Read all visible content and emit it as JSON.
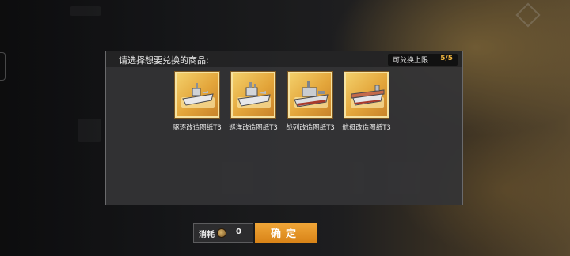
{
  "dialog": {
    "title": "请选择想要兑换的商品:",
    "limit_label": "可兑换上限",
    "limit_value": "5/5"
  },
  "items": [
    {
      "label": "驱逐改造图纸T3",
      "icon": "destroyer-blueprint-icon"
    },
    {
      "label": "巡洋改造图纸T3",
      "icon": "cruiser-blueprint-icon"
    },
    {
      "label": "战列改造图纸T3",
      "icon": "battleship-blueprint-icon"
    },
    {
      "label": "航母改造图纸T3",
      "icon": "carrier-blueprint-icon"
    }
  ],
  "footer": {
    "cost_label": "消耗",
    "cost_icon": "coin-icon",
    "cost_value": "0",
    "confirm_label": "确定"
  },
  "colors": {
    "accent": "#e8961f",
    "limit_value": "#f0b640",
    "icon_background": "#e3a53a"
  }
}
